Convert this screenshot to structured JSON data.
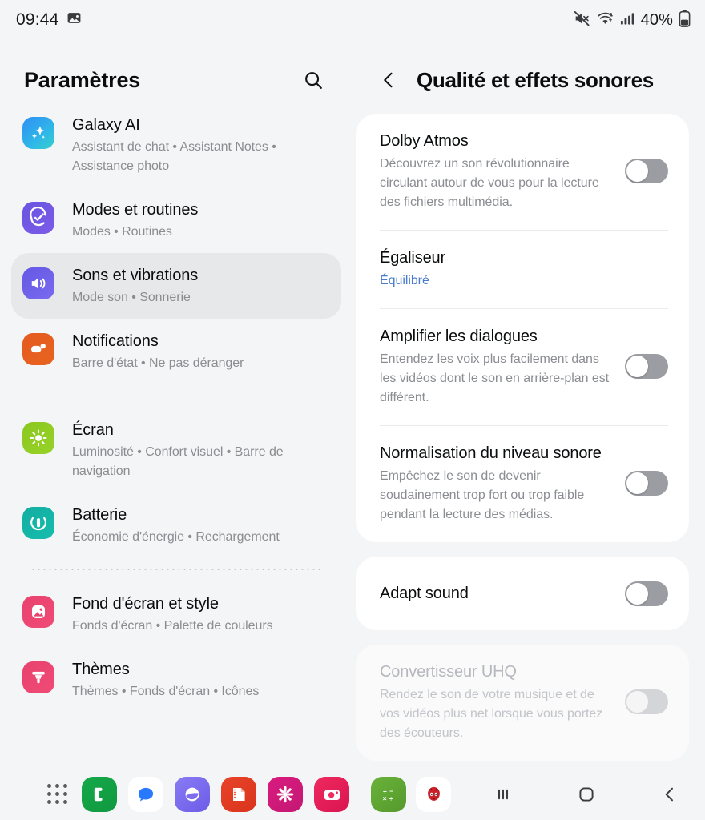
{
  "status_bar": {
    "clock": "09:44",
    "icons_left": [
      "image-icon"
    ],
    "icons_right": [
      "mute-icon",
      "wifi-icon",
      "signal-icon"
    ],
    "battery_percent": "40%",
    "battery_icon": "battery-icon"
  },
  "sidebar": {
    "title": "Paramètres",
    "search_icon": "search-icon",
    "groups": [
      {
        "items": [
          {
            "label": "Galaxy AI",
            "sub": "Assistant de chat  •  Assistant Notes  •  Assistance photo",
            "icon": "galaxy-ai-icon",
            "color": "#2f9bf2",
            "selected": false
          },
          {
            "label": "Modes et routines",
            "sub": "Modes  •  Routines",
            "icon": "modes-routines-icon",
            "color": "#6a55e0",
            "selected": false
          },
          {
            "label": "Sons et vibrations",
            "sub": "Mode son  •  Sonnerie",
            "icon": "sound-vibration-icon",
            "color": "#6558e3",
            "selected": true
          },
          {
            "label": "Notifications",
            "sub": "Barre d'état  •  Ne pas déranger",
            "icon": "notifications-icon",
            "color": "#e35a1f",
            "selected": false
          }
        ]
      },
      {
        "items": [
          {
            "label": "Écran",
            "sub": "Luminosité  •  Confort visuel  •  Barre de navigation",
            "icon": "display-icon",
            "color": "#8bc820",
            "selected": false
          },
          {
            "label": "Batterie",
            "sub": "Économie d'énergie  •  Rechargement",
            "icon": "battery-settings-icon",
            "color": "#15b0a3",
            "selected": false
          }
        ]
      },
      {
        "items": [
          {
            "label": "Fond d'écran et style",
            "sub": "Fonds d'écran  •  Palette de couleurs",
            "icon": "wallpaper-icon",
            "color": "#e8436e",
            "selected": false
          },
          {
            "label": "Thèmes",
            "sub": "Thèmes  •  Fonds d'écran  •  Icônes",
            "icon": "themes-icon",
            "color": "#e8436e",
            "selected": false
          }
        ]
      }
    ]
  },
  "detail": {
    "back_icon": "back-chevron-icon",
    "title": "Qualité et effets sonores",
    "cards": [
      {
        "disabled": false,
        "rows": [
          {
            "title": "Dolby Atmos",
            "sub": "Découvrez un son révolutionnaire circulant autour de vous pour la lecture des fichiers multimédia.",
            "sub_style": "normal",
            "control": "toggle",
            "toggle_state": "off",
            "has_divider_bar": true
          },
          {
            "title": "Égaliseur",
            "sub": "Équilibré",
            "sub_style": "link",
            "control": "none",
            "toggle_state": "",
            "has_divider_bar": false
          },
          {
            "title": "Amplifier les dialogues",
            "sub": "Entendez les voix plus facilement dans les vidéos dont le son en arrière-plan est différent.",
            "sub_style": "normal",
            "control": "toggle",
            "toggle_state": "off",
            "has_divider_bar": false
          },
          {
            "title": "Normalisation du niveau sonore",
            "sub": "Empêchez le son de devenir soudainement trop fort ou trop faible pendant la lecture des médias.",
            "sub_style": "normal",
            "control": "toggle",
            "toggle_state": "off",
            "has_divider_bar": false
          }
        ]
      },
      {
        "disabled": false,
        "rows": [
          {
            "title": "Adapt sound",
            "sub": "",
            "sub_style": "normal",
            "control": "toggle",
            "toggle_state": "off",
            "has_divider_bar": true
          }
        ]
      },
      {
        "disabled": true,
        "rows": [
          {
            "title": "Convertisseur UHQ",
            "sub": "Rendez le son de votre musique et de vos vidéos plus net lorsque vous portez des écouteurs.",
            "sub_style": "muted",
            "control": "toggle",
            "toggle_state": "off-faded",
            "has_divider_bar": false
          }
        ]
      }
    ]
  },
  "dock": {
    "apps_button": "app-drawer-icon",
    "apps": [
      {
        "name": "phone-app-icon",
        "color": "#14a44a"
      },
      {
        "name": "messages-app-icon",
        "color": "#ffffff"
      },
      {
        "name": "internet-app-icon",
        "color": "#7b6cf0"
      },
      {
        "name": "notes-app-icon",
        "color": "#e03a23"
      },
      {
        "name": "gallery-app-icon",
        "color": "#d61b7a"
      },
      {
        "name": "camera-app-icon",
        "color": "#e3225b"
      }
    ],
    "recent_apps": [
      {
        "name": "calculator-app-icon",
        "color": "#5fa832"
      },
      {
        "name": "antutu-app-icon",
        "color": "#ffffff"
      }
    ],
    "nav": [
      {
        "name": "recents-button"
      },
      {
        "name": "home-button"
      },
      {
        "name": "back-button"
      }
    ]
  },
  "colors": {
    "page_bg": "#f4f5f7",
    "card_bg": "#ffffff",
    "selected_bg": "#e7e8ea",
    "accent_link": "#4a7ccd",
    "toggle_off": "#9b9da2"
  }
}
